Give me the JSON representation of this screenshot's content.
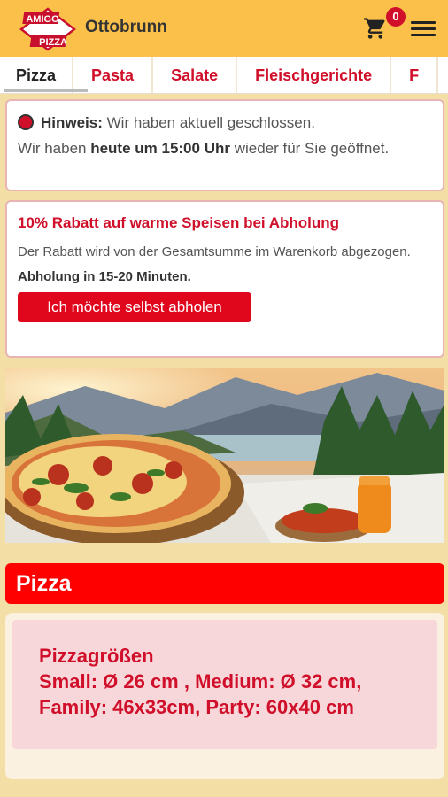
{
  "header": {
    "logo_text_top": "AMIGO",
    "logo_text_bottom": "PIZZA",
    "city": "Ottobrunn",
    "cart_count": "0",
    "icons": {
      "cart": "cart-icon",
      "menu": "hamburger-menu-icon",
      "logo": "amigo-pizza-logo"
    }
  },
  "tabs": [
    {
      "label": "Pizza",
      "active": true
    },
    {
      "label": "Pasta"
    },
    {
      "label": "Salate"
    },
    {
      "label": "Fleischgerichte"
    },
    {
      "label": "F"
    }
  ],
  "notice": {
    "label": "Hinweis:",
    "text1": " Wir haben aktuell geschlossen.",
    "text2": "Wir haben ",
    "time": "heute um 15:00 Uhr",
    "text3": " wieder für Sie geöffnet.",
    "status_color": "#d0102a"
  },
  "discount": {
    "title": "10% Rabatt auf warme Speisen bei Abholung",
    "description": "Der Rabatt wird von der Gesamtsumme im Warenkorb abgezogen.",
    "pickup_time": "Abholung in 15-20 Minuten.",
    "button_label": "Ich möchte selbst abholen"
  },
  "section": {
    "title": "Pizza",
    "info_title": "Pizzagrößen",
    "info_line1": "Small: Ø 26 cm , Medium: Ø 32 cm,",
    "info_line2": "Family: 46x33cm, Party: 60x40 cm"
  },
  "colors": {
    "header_bg": "#fbc04a",
    "accent_red": "#d0102a",
    "section_red": "#ff0000",
    "page_bg": "#f3dfa6"
  }
}
